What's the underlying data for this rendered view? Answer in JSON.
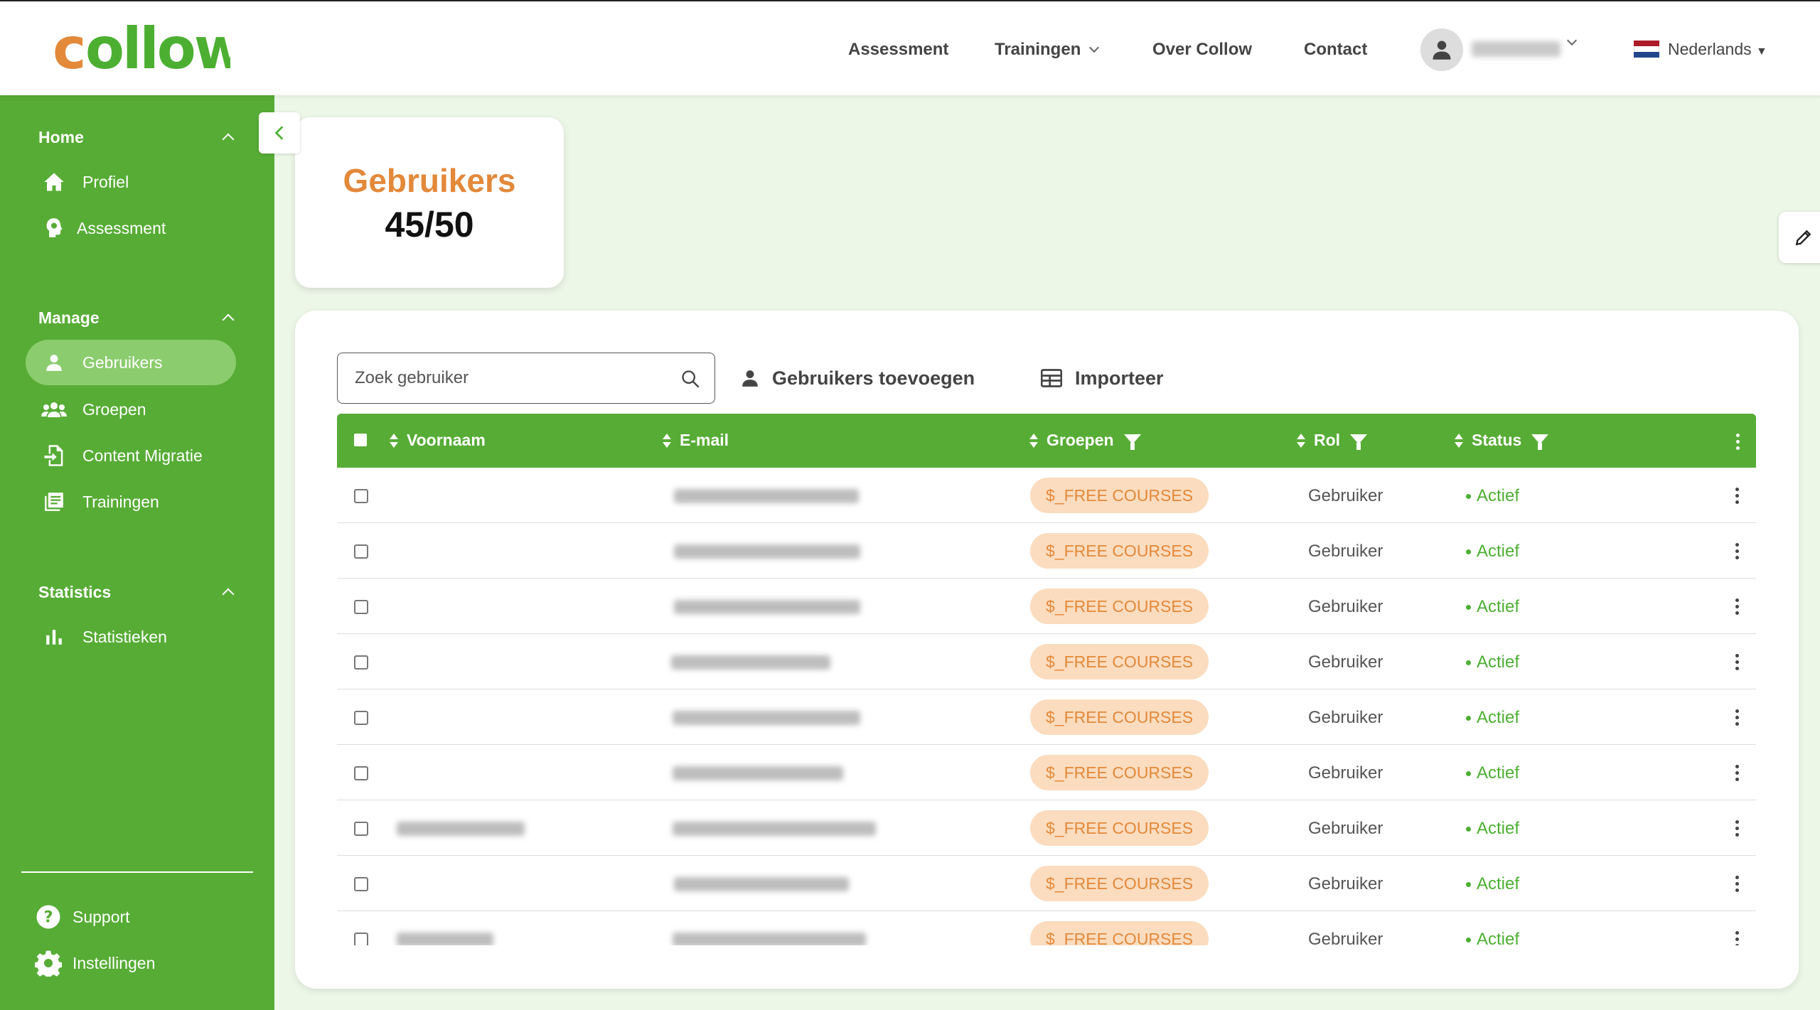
{
  "header": {
    "logo_text": "collow",
    "nav": [
      {
        "label": "Assessment"
      },
      {
        "label": "Trainingen"
      },
      {
        "label": "Over Collow"
      },
      {
        "label": "Contact"
      }
    ],
    "language": "Nederlands",
    "colors": {
      "brand_green": "#57ac35",
      "brand_orange": "#e3893a"
    }
  },
  "sidebar": {
    "sections": [
      {
        "title": "Home",
        "items": [
          {
            "label": "Profiel",
            "icon": "home-icon"
          },
          {
            "label": "Assessment",
            "icon": "brain-icon"
          }
        ]
      },
      {
        "title": "Manage",
        "items": [
          {
            "label": "Gebruikers",
            "icon": "user-icon",
            "active": true
          },
          {
            "label": "Groepen",
            "icon": "group-icon"
          },
          {
            "label": "Content Migratie",
            "icon": "file-import-icon"
          },
          {
            "label": "Trainingen",
            "icon": "list-icon"
          }
        ]
      },
      {
        "title": "Statistics",
        "items": [
          {
            "label": "Statistieken",
            "icon": "bar-chart-icon"
          }
        ]
      }
    ],
    "footer": [
      {
        "label": "Support",
        "icon": "help-icon"
      },
      {
        "label": "Instellingen",
        "icon": "gear-icon"
      }
    ]
  },
  "stat_card": {
    "title": "Gebruikers",
    "value": "45/50"
  },
  "toolbar": {
    "search_placeholder": "Zoek gebruiker",
    "add_users_label": "Gebruikers toevoegen",
    "import_label": "Importeer"
  },
  "table": {
    "columns": [
      "Voornaam",
      "E-mail",
      "Groepen",
      "Rol",
      "Status"
    ],
    "rows": [
      {
        "group": "$_FREE COURSES",
        "role": "Gebruiker",
        "status": "Actief"
      },
      {
        "group": "$_FREE COURSES",
        "role": "Gebruiker",
        "status": "Actief"
      },
      {
        "group": "$_FREE COURSES",
        "role": "Gebruiker",
        "status": "Actief"
      },
      {
        "group": "$_FREE COURSES",
        "role": "Gebruiker",
        "status": "Actief"
      },
      {
        "group": "$_FREE COURSES",
        "role": "Gebruiker",
        "status": "Actief"
      },
      {
        "group": "$_FREE COURSES",
        "role": "Gebruiker",
        "status": "Actief"
      },
      {
        "group": "$_FREE COURSES",
        "role": "Gebruiker",
        "status": "Actief"
      },
      {
        "group": "$_FREE COURSES",
        "role": "Gebruiker",
        "status": "Actief"
      },
      {
        "group": "$_FREE COURSES",
        "role": "Gebruiker",
        "status": "Actief"
      }
    ]
  }
}
